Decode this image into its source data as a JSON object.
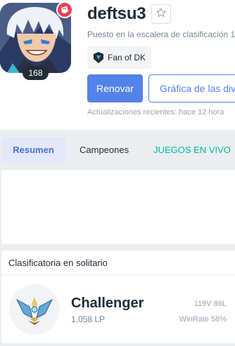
{
  "profile": {
    "name": "deftsu3",
    "level": "168",
    "ladder_rank_text": "Puesto en la escalera de clasificación 1",
    "fan_tag": "Fan of DK",
    "renew_label": "Renovar",
    "graph_label": "Gráfica de las divi",
    "updated_text": "Actualizaciones recientes: hace 12 hora"
  },
  "tabs": [
    {
      "label": "Resumen"
    },
    {
      "label": "Campeones"
    },
    {
      "label": "JUEGOS EN VIVO"
    }
  ],
  "ranked": {
    "title": "Clasificatoria en solitario",
    "tier": "Challenger",
    "lp": "1,058 LP",
    "win_loss": "119V 86L",
    "win_rate": "WinRate 58%"
  },
  "icons": {
    "favorite": "star-outline-icon",
    "riot": "riot-fist-icon",
    "fan": "dk-team-logo-icon",
    "emblem": "challenger-emblem-icon"
  },
  "colors": {
    "accent": "#5383e8",
    "live": "#00bba3",
    "riot_red": "#e84057"
  }
}
